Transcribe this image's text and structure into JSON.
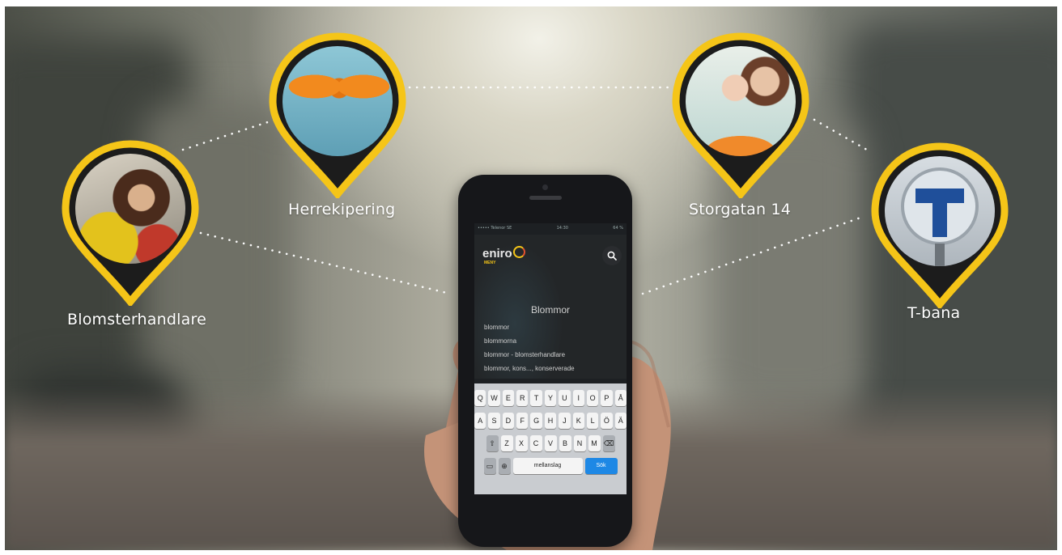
{
  "scene": {
    "pins": [
      {
        "label": "Blomsterhandlare",
        "photo_icon": "florist-photo-icon"
      },
      {
        "label": "Herrekipering",
        "photo_icon": "bowtie-photo-icon"
      },
      {
        "label": "Storgatan 14",
        "photo_icon": "family-photo-icon"
      },
      {
        "label": "T-bana",
        "photo_icon": "subway-sign-photo-icon"
      }
    ],
    "pin_ring_color": "#f5c518",
    "pin_body_color": "#1c1c1c"
  },
  "phone": {
    "status_left": "••••• Telenor SE",
    "status_time": "14:30",
    "status_right": "64 %",
    "brand": "eniro",
    "menu_label": "MENY",
    "search_query": "Blommor",
    "suggestions": [
      "blommor",
      "blommorna",
      "blommor - blomsterhandlare",
      "blommor, kons..., konserverade"
    ],
    "keyboard": {
      "row1": [
        "Q",
        "W",
        "E",
        "R",
        "T",
        "Y",
        "U",
        "I",
        "O",
        "P",
        "Å"
      ],
      "row2": [
        "A",
        "S",
        "D",
        "F",
        "G",
        "H",
        "J",
        "K",
        "L",
        "Ö",
        "Ä"
      ],
      "row3": [
        "Z",
        "X",
        "C",
        "V",
        "B",
        "N",
        "M"
      ],
      "space_label": "mellanslag",
      "go_label": "Sök",
      "go_color": "#1e88e5"
    }
  }
}
